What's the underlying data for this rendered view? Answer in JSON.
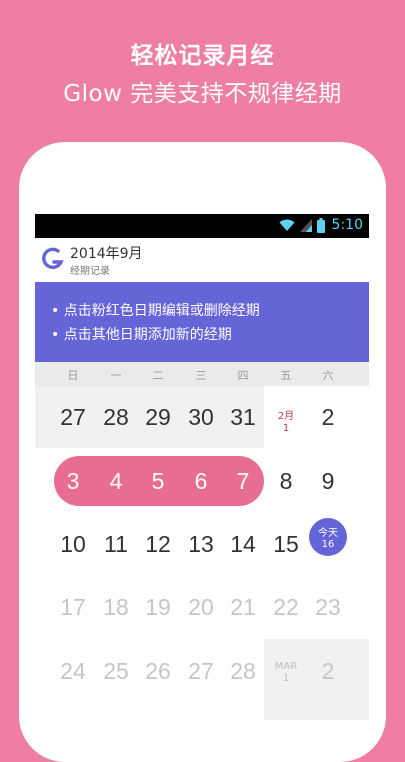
{
  "headline": {
    "line1": "轻松记录月经",
    "line2": "Glow 完美支持不规律经期"
  },
  "statusbar": {
    "time": "5:10",
    "icons": [
      "wifi-icon",
      "signal-icon",
      "battery-icon"
    ]
  },
  "appbar": {
    "title": "2014年9月",
    "subtitle": "经期记录",
    "logo": "glow-logo"
  },
  "tips": [
    "• 点击粉红色日期编辑或删除经期",
    "• 点击其他日期添加新的经期"
  ],
  "weekdays": [
    "日",
    "一",
    "二",
    "三",
    "四",
    "五",
    "六"
  ],
  "calendar": {
    "weeks": [
      [
        "27",
        "28",
        "29",
        "30",
        "31",
        "",
        "2"
      ],
      [
        "3",
        "4",
        "5",
        "6",
        "7",
        "8",
        "9"
      ],
      [
        "10",
        "11",
        "12",
        "13",
        "14",
        "15",
        ""
      ],
      [
        "17",
        "18",
        "19",
        "20",
        "21",
        "22",
        "23"
      ],
      [
        "24",
        "25",
        "26",
        "27",
        "28",
        "",
        "2"
      ]
    ],
    "month_marker_sep": {
      "month": "2月",
      "day": "1"
    },
    "month_marker_mar": {
      "month": "MAR",
      "day": "1"
    },
    "today": {
      "label": "今天",
      "day": "16"
    },
    "colors": {
      "period": "#e76d92",
      "accent": "#6565d8",
      "background": "#ee7fa3"
    }
  }
}
